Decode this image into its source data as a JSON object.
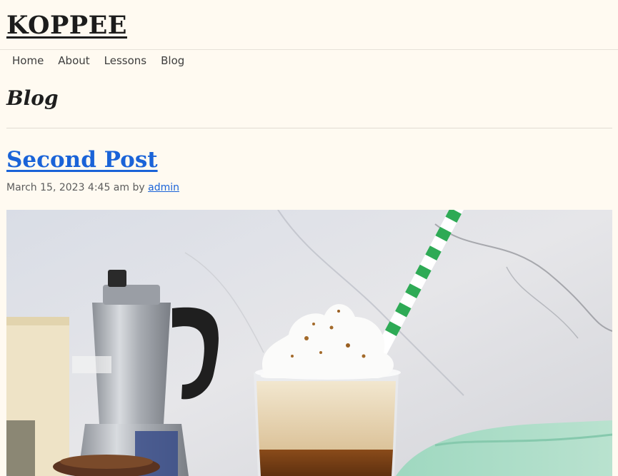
{
  "site": {
    "title": "KOPPEE"
  },
  "nav": {
    "items": [
      "Home",
      "About",
      "Lessons",
      "Blog"
    ]
  },
  "page": {
    "title": "Blog"
  },
  "post": {
    "title": "Second Post",
    "date": "March 15, 2023 4:45 am",
    "by": "by",
    "author": "admin"
  },
  "colors": {
    "background": "#fffaf1",
    "link": "#1a63d8",
    "straw_green": "#2eaa55"
  },
  "icons": {
    "image": "iced-coffee-photo"
  }
}
